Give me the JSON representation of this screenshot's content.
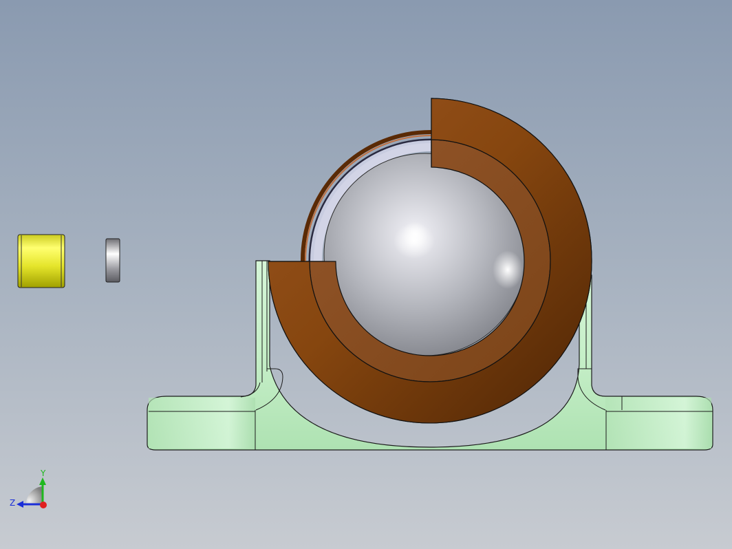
{
  "view": {
    "background_top": "#8a9ab0",
    "background_bottom": "#c7cbd1"
  },
  "parts": [
    {
      "name": "pillow-block-housing",
      "color": "#c6f0c8"
    },
    {
      "name": "outer-bearing-ring-sectioned",
      "color": "#8a4a14"
    },
    {
      "name": "inner-bearing-ring-sectioned",
      "color": "#8f5426"
    },
    {
      "name": "bearing-ball",
      "color": "#c7c9d0"
    },
    {
      "name": "cylinder-sleeve",
      "color": "#e8e83a"
    },
    {
      "name": "washer",
      "color": "#b9b9bf"
    }
  ],
  "triad": {
    "y_label": "Y",
    "z_label": "Z",
    "y_color": "#1fb81f",
    "z_color": "#1a2ed8",
    "x_color": "#e02020"
  }
}
